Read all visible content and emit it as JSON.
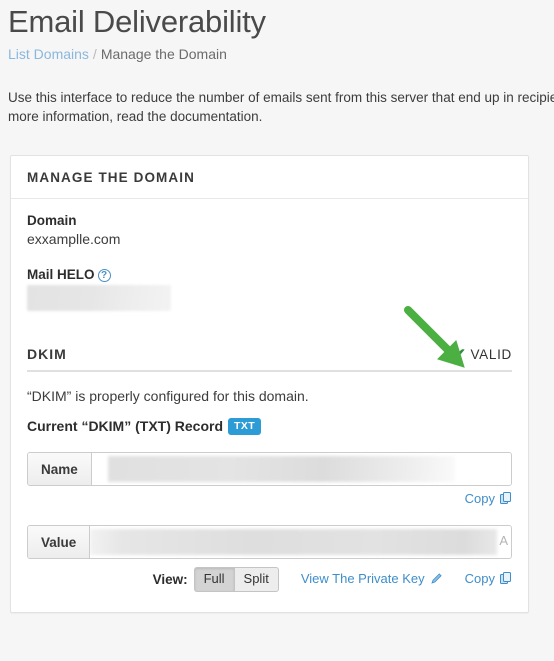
{
  "header": {
    "title": "Email Deliverability",
    "breadcrumb": {
      "link_label": "List Domains",
      "separator": "/",
      "current_label": "Manage the Domain"
    },
    "intro": "Use this interface to reduce the number of emails sent from this server that end up in recipients' spam folders. For more information, read the documentation."
  },
  "card": {
    "header_title": "Manage the Domain",
    "domain": {
      "label": "Domain",
      "value": "exxamplle.com"
    },
    "mail_helo": {
      "label": "Mail HELO",
      "help_icon_glyph": "?",
      "value": ""
    }
  },
  "dkim": {
    "section_title": "DKIM",
    "status_label": "VALID",
    "status_check_glyph": "✔",
    "status_color": "#2f8f3e",
    "description": "“DKIM” is properly configured for this domain.",
    "record_title": "Current “DKIM” (TXT) Record",
    "record_badge": "TXT",
    "badge_color": "#2d9cd6",
    "name_row": {
      "addon_label": "Name",
      "value": "",
      "copy_label": "Copy"
    },
    "value_row": {
      "addon_label": "Value",
      "value": "",
      "value_tail_glyph": "A",
      "copy_label": "Copy"
    },
    "view_controls": {
      "label": "View:",
      "options": [
        "Full",
        "Split"
      ],
      "selected": "Full"
    },
    "private_key_link": "View The Private Key"
  },
  "annotation": {
    "arrow_color": "#4caf42",
    "points_to": "VALID"
  },
  "colors": {
    "page_background": "#f6f6f6",
    "card_background": "#ffffff",
    "link": "#3f8ecb",
    "breadcrumb_link": "#8ab8dd"
  }
}
